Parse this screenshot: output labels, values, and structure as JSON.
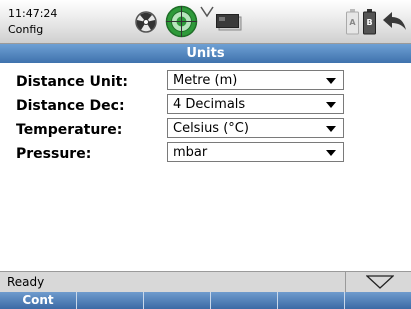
{
  "status_bar": {
    "time": "11:47:24",
    "mode": "Config",
    "icons": [
      "fan-icon",
      "target-icon",
      "wifi-icon",
      "card-icon",
      "battery-a-icon",
      "battery-b-icon",
      "back-arrow-icon"
    ],
    "battery_a_label": "A",
    "battery_b_label": "B"
  },
  "title": "Units",
  "settings": [
    {
      "label": "Distance Unit:",
      "value": "Metre (m)"
    },
    {
      "label": "Distance Dec:",
      "value": "4 Decimals"
    },
    {
      "label": "Temperature:",
      "value": "Celsius (°C)"
    },
    {
      "label": "Pressure:",
      "value": "mbar"
    }
  ],
  "footer": {
    "status": "Ready",
    "softkeys": [
      "Cont",
      "",
      "",
      "",
      "",
      ""
    ]
  },
  "colors": {
    "accent": "#3f72ad",
    "target_green": "#2e9a3a"
  }
}
